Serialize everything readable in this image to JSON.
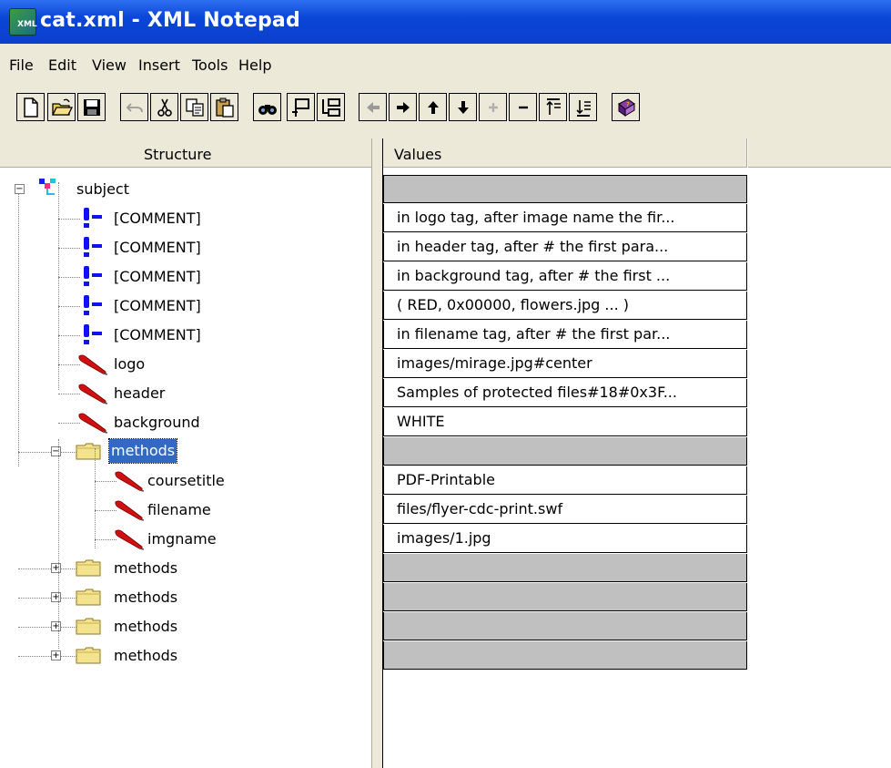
{
  "window": {
    "title": "cat.xml - XML Notepad"
  },
  "menu": [
    "File",
    "Edit",
    "View",
    "Insert",
    "Tools",
    "Help"
  ],
  "toolbar": {
    "buttons": [
      "new-icon",
      "open-icon",
      "save-icon",
      "undo-icon",
      "cut-icon",
      "copy-icon",
      "paste-icon",
      "find-icon",
      "insert-element-icon",
      "change-to-icon",
      "nudge-left-icon",
      "nudge-right-icon",
      "nudge-up-icon",
      "nudge-down-icon",
      "expand-icon",
      "collapse-icon",
      "expand-all-icon",
      "collapse-all-icon",
      "help-icon"
    ]
  },
  "tree": {
    "header": "Structure",
    "nodes": [
      {
        "label": "subject",
        "type": "root"
      },
      {
        "label": "[COMMENT]",
        "type": "comment"
      },
      {
        "label": "[COMMENT]",
        "type": "comment"
      },
      {
        "label": "[COMMENT]",
        "type": "comment"
      },
      {
        "label": "[COMMENT]",
        "type": "comment"
      },
      {
        "label": "[COMMENT]",
        "type": "comment"
      },
      {
        "label": "logo",
        "type": "text"
      },
      {
        "label": "header",
        "type": "text"
      },
      {
        "label": "background",
        "type": "text"
      },
      {
        "label": "methods",
        "type": "folder",
        "expanded": true,
        "selected": true
      },
      {
        "label": "coursetitle",
        "type": "text"
      },
      {
        "label": "filename",
        "type": "text"
      },
      {
        "label": "imgname",
        "type": "text"
      },
      {
        "label": "methods",
        "type": "folder",
        "expanded": false
      },
      {
        "label": "methods",
        "type": "folder",
        "expanded": false
      },
      {
        "label": "methods",
        "type": "folder",
        "expanded": false
      },
      {
        "label": "methods",
        "type": "folder",
        "expanded": false
      }
    ]
  },
  "values": {
    "header": "Values",
    "rows": [
      "",
      "in logo tag, after image name the fir...",
      "in header tag, after # the first para...",
      "in background tag, after # the first ...",
      " ( RED, 0x00000, flowers.jpg ... )",
      "in filename tag, after # the first par...",
      "images/mirage.jpg#center",
      "Samples of protected files#18#0x3F...",
      "WHITE",
      "",
      "PDF-Printable",
      "files/flyer-cdc-print.swf",
      "images/1.jpg",
      "",
      "",
      "",
      ""
    ]
  },
  "colors": {
    "titlebar": "#0a46d8",
    "selection": "#316ac5",
    "chrome": "#ece9d8",
    "grey_cell": "#c0c0c0"
  }
}
